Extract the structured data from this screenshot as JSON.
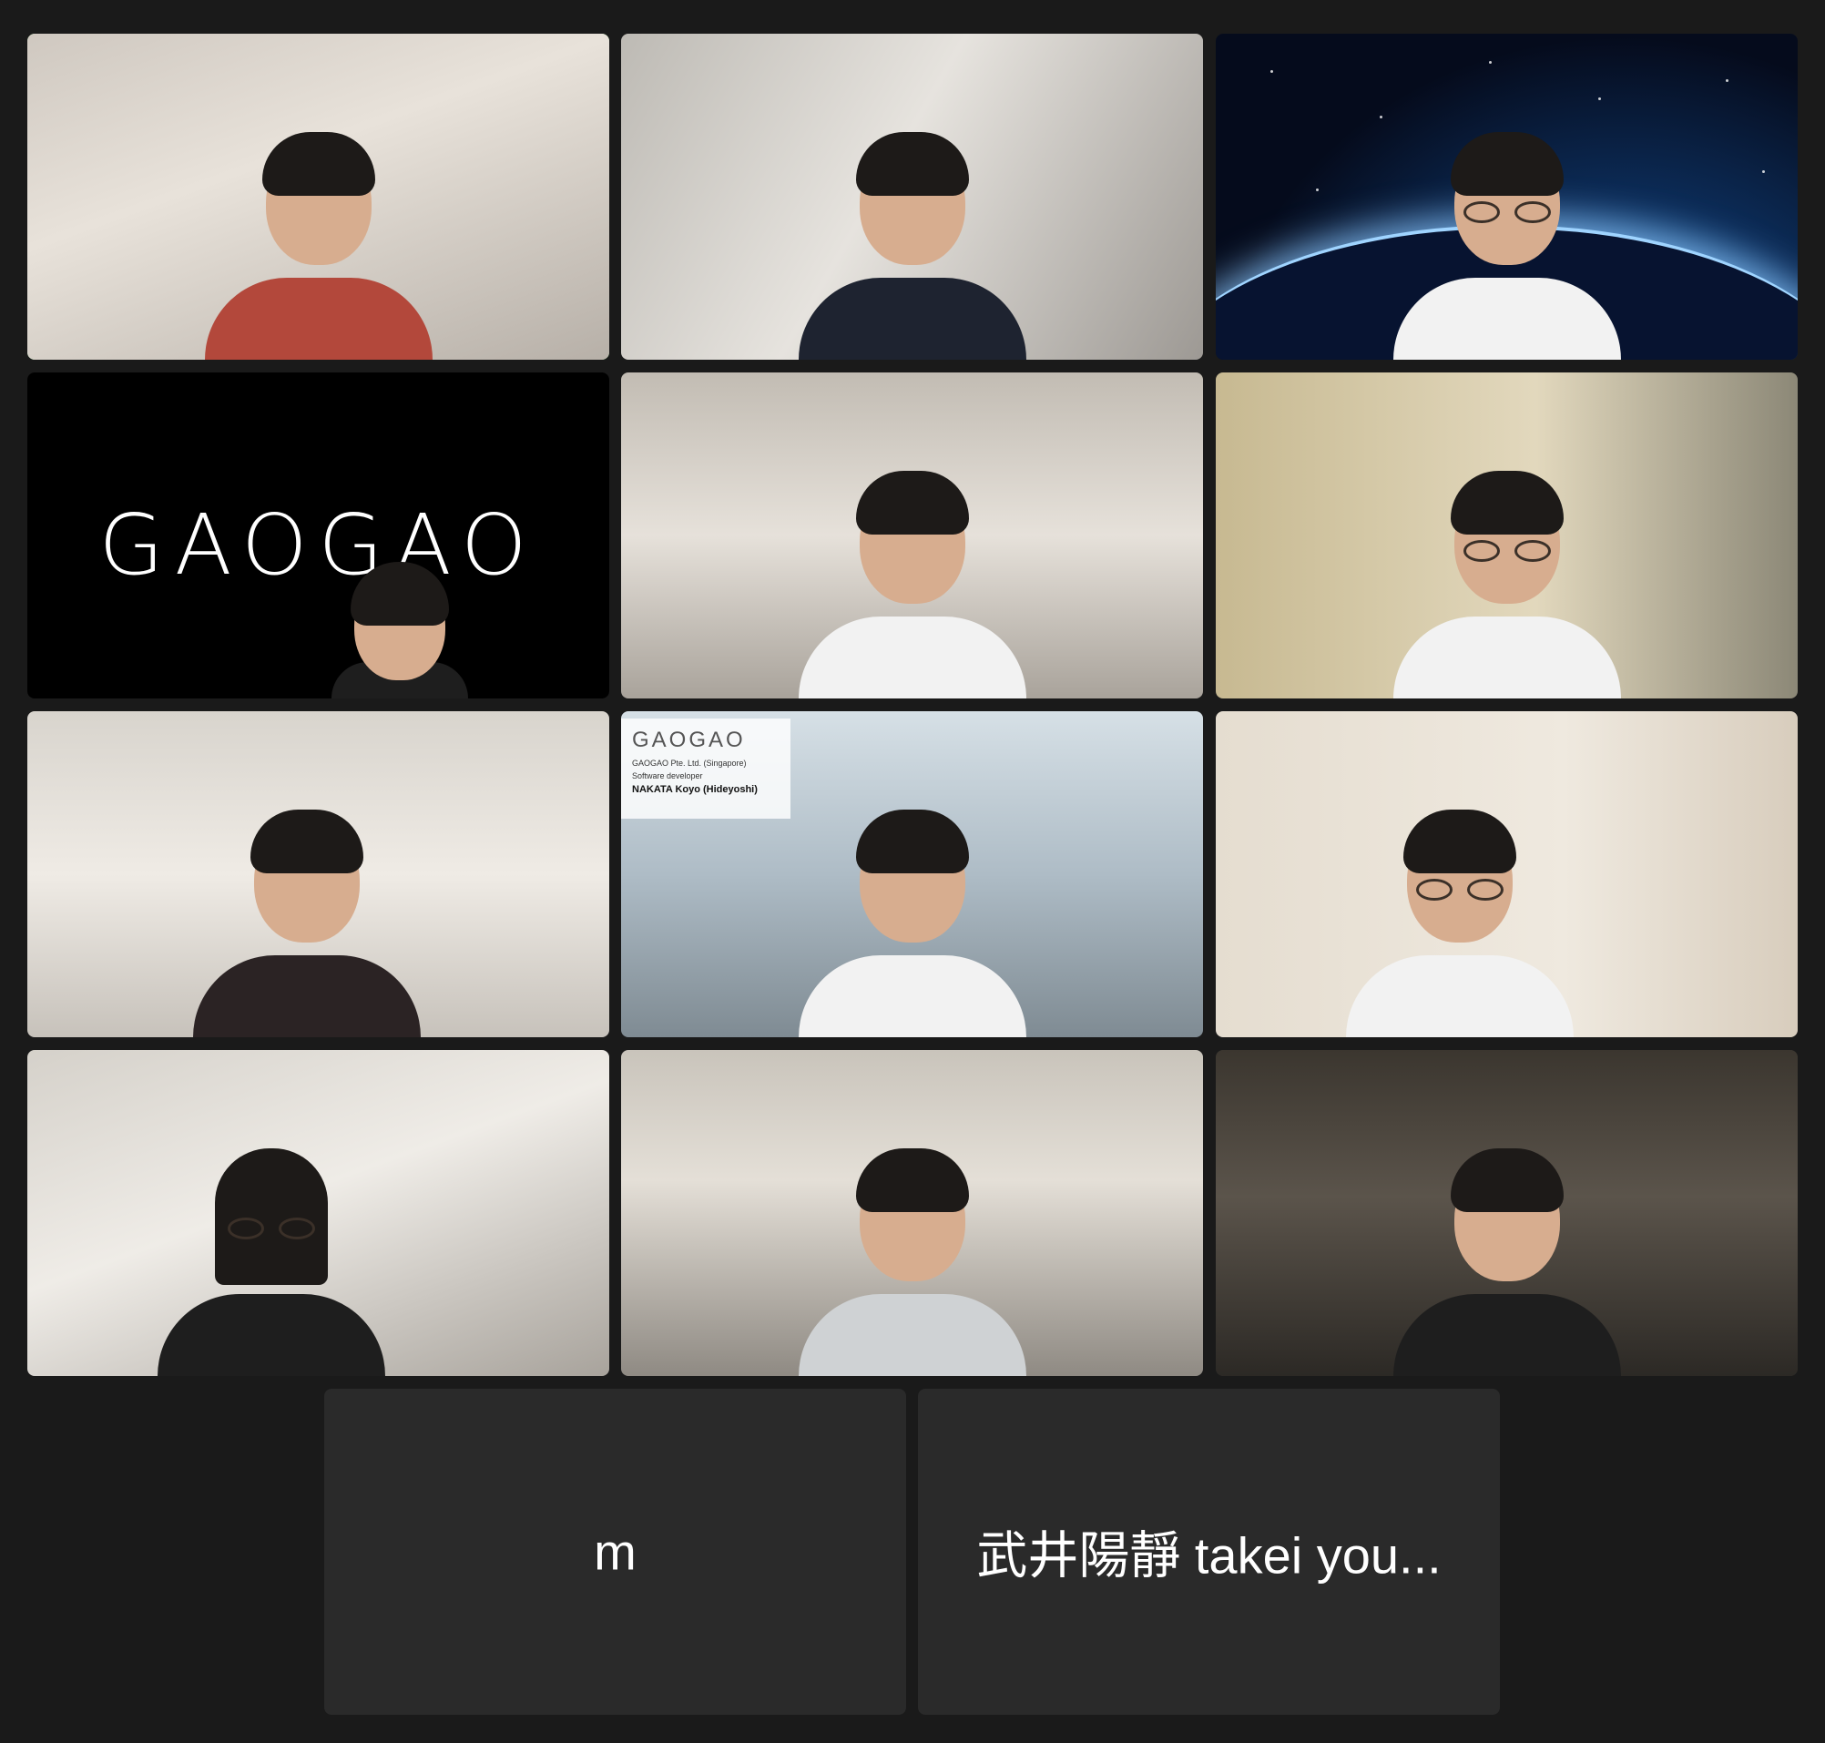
{
  "meeting": {
    "view": "Gallery View",
    "active_speaker_color": "#4fd157",
    "background_color": "#1a1a1a"
  },
  "tiles": [
    {
      "id": 1,
      "type": "video",
      "active": true
    },
    {
      "id": 2,
      "type": "video"
    },
    {
      "id": 3,
      "type": "video",
      "background": "space"
    },
    {
      "id": 4,
      "type": "video",
      "banner_text": "GAOGAO"
    },
    {
      "id": 5,
      "type": "video"
    },
    {
      "id": 6,
      "type": "video"
    },
    {
      "id": 7,
      "type": "video"
    },
    {
      "id": 8,
      "type": "video",
      "lower_third": {
        "logo": "GAOGAO",
        "company": "GAOGAO Pte. Ltd. (Singapore)",
        "role": "Software developer",
        "name": "NAKATA Koyo (Hideyoshi)"
      }
    },
    {
      "id": 9,
      "type": "video"
    },
    {
      "id": 10,
      "type": "video"
    },
    {
      "id": 11,
      "type": "video"
    },
    {
      "id": 12,
      "type": "video"
    }
  ],
  "name_tiles": [
    {
      "id": 13,
      "name": "m"
    },
    {
      "id": 14,
      "name": "武井陽靜 takei you..."
    }
  ]
}
